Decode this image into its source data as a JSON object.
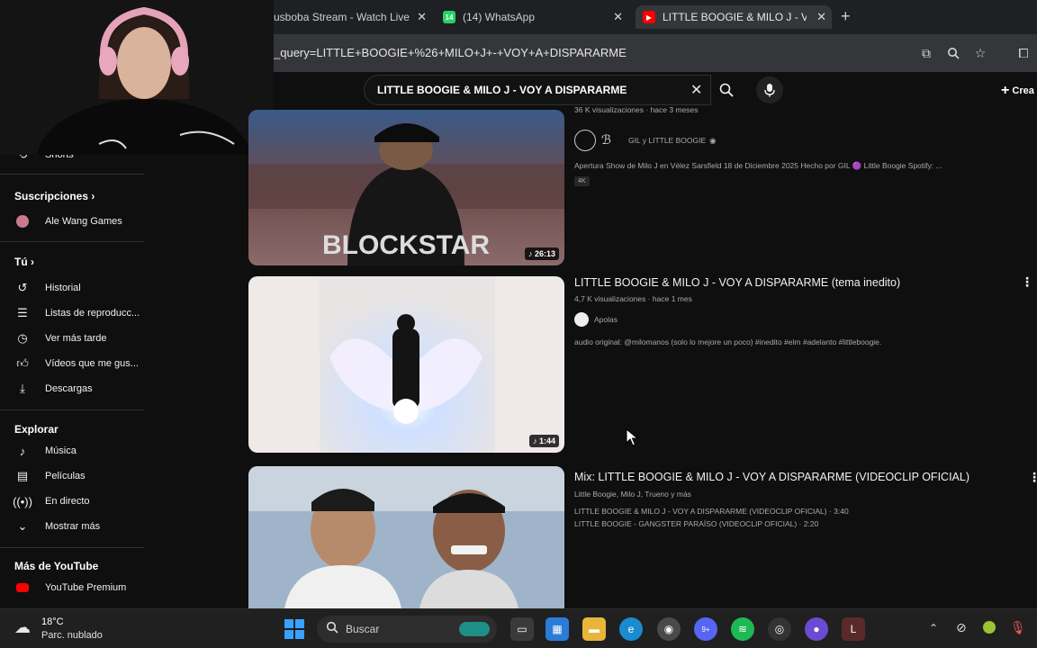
{
  "browser": {
    "tabs": [
      {
        "title": "usboba Stream - Watch Live",
        "icon": "stream-icon"
      },
      {
        "title": "(14) WhatsApp",
        "icon": "whatsapp-icon",
        "badge": "14"
      },
      {
        "title": "LITTLE BOOGIE & MILO J - VOY",
        "icon": "youtube-icon"
      }
    ],
    "url": "_query=LITTLE+BOOGIE+%26+MILO+J+-+VOY+A+DISPARARME"
  },
  "youtube": {
    "search_query": "LITTLE BOOGIE & MILO J - VOY A DISPARARME",
    "create_label": "Crea"
  },
  "sidebar": {
    "shorts": "Shorts",
    "subscriptions_heading": "Suscripciones",
    "subscriptions": [
      {
        "label": "Ale Wang Games"
      }
    ],
    "you_heading": "Tú",
    "you_items": [
      {
        "label": "Historial",
        "icon": "history-icon"
      },
      {
        "label": "Listas de reproducc...",
        "icon": "playlist-icon"
      },
      {
        "label": "Ver más tarde",
        "icon": "watch-later-icon"
      },
      {
        "label": "Vídeos que me gus...",
        "icon": "thumbs-up-icon"
      },
      {
        "label": "Descargas",
        "icon": "download-icon"
      }
    ],
    "explore_heading": "Explorar",
    "explore_items": [
      {
        "label": "Música",
        "icon": "music-icon"
      },
      {
        "label": "Películas",
        "icon": "movies-icon"
      },
      {
        "label": "En directo",
        "icon": "live-icon"
      },
      {
        "label": "Mostrar más",
        "icon": "chevron-down-icon"
      }
    ],
    "more_heading": "Más de YouTube",
    "more_items": [
      {
        "label": "YouTube Premium",
        "icon": "youtube-premium-icon"
      }
    ]
  },
  "results": [
    {
      "meta": "36 K visualizaciones · hace 3 meses",
      "channel": "GIL y LITTLE BOOGIE",
      "description": "Apertura Show de Milo J en Vélez Sarsfield 18 de Diciembre 2025 Hecho por GIL 🟣 Little Boogie Spotify: ...",
      "badge": "4K",
      "duration": "26:13",
      "thumb_text": "BLOCKSTAR"
    },
    {
      "title": "LITTLE BOOGIE & MILO J - VOY A DISPARARME (tema inedito)",
      "meta": "4,7 K visualizaciones · hace 1 mes",
      "channel": "Apolas",
      "description": "audio original: @milomanos (solo lo mejore un poco) #inedito #elm #adelanto #littleboogie.",
      "duration": "1:44"
    },
    {
      "title": "Mix: LITTLE BOOGIE & MILO J - VOY A DISPARARME (VIDEOCLIP OFICIAL)",
      "meta": "Little Boogie, Milo J, Trueno y más",
      "lines": [
        "LITTLE BOOGIE & MILO J - VOY A DISPARARME (VIDEOCLIP OFICIAL) · 3:40",
        "LITTLE BOOGIE - GANGSTER PARAÍSO (VIDEOCLIP OFICIAL) · 2:20"
      ]
    }
  ],
  "taskbar": {
    "temp": "18°C",
    "weather": "Parc. nublado",
    "search_placeholder": "Buscar",
    "discord_badge": "9+"
  }
}
